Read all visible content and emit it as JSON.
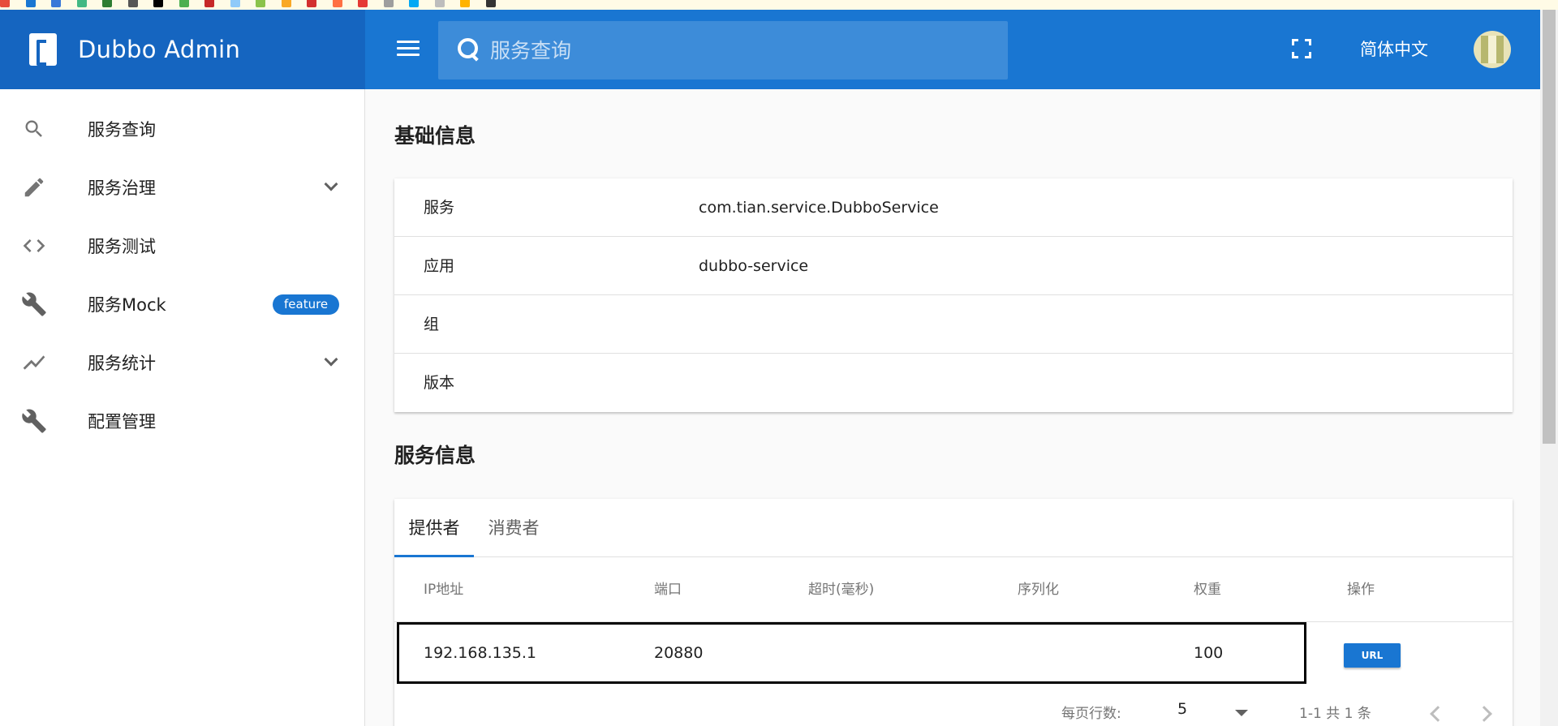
{
  "app": {
    "title": "Dubbo Admin",
    "lang_label": "简体中文"
  },
  "search": {
    "placeholder": "服务查询"
  },
  "sidebar": {
    "items": [
      {
        "label": "服务查询",
        "icon": "search-icon"
      },
      {
        "label": "服务治理",
        "icon": "pencil-icon",
        "expandable": true
      },
      {
        "label": "服务测试",
        "icon": "code-icon"
      },
      {
        "label": "服务Mock",
        "icon": "wrench-icon",
        "badge": "feature"
      },
      {
        "label": "服务统计",
        "icon": "trending-icon",
        "expandable": true
      },
      {
        "label": "配置管理",
        "icon": "wrench-icon"
      }
    ]
  },
  "basic": {
    "title": "基础信息",
    "rows": [
      {
        "key": "服务",
        "value": "com.tian.service.DubboService"
      },
      {
        "key": "应用",
        "value": "dubbo-service"
      },
      {
        "key": "组",
        "value": ""
      },
      {
        "key": "版本",
        "value": ""
      }
    ]
  },
  "service_info": {
    "title": "服务信息",
    "tabs": [
      {
        "label": "提供者",
        "active": true
      },
      {
        "label": "消费者",
        "active": false
      }
    ],
    "columns": [
      "IP地址",
      "端口",
      "超时(毫秒)",
      "序列化",
      "权重",
      "操作"
    ],
    "rows": [
      {
        "ip": "192.168.135.1",
        "port": "20880",
        "timeout": "",
        "serialization": "",
        "weight": "100",
        "action": "URL"
      }
    ],
    "footer": {
      "rows_per_page_label": "每页行数:",
      "rows_per_page": "5",
      "range": "1-1 共 1 条"
    }
  },
  "colors": {
    "primary": "#1976d2",
    "primary_dark": "#1565c0"
  }
}
